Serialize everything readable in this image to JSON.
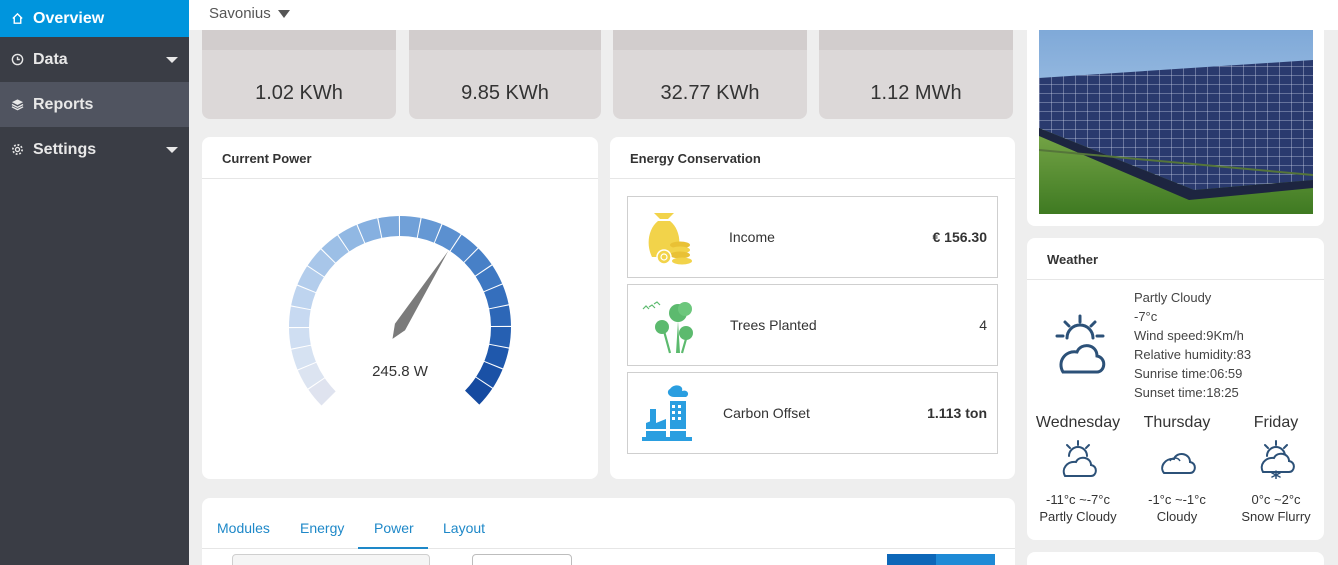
{
  "sidebar": {
    "items": [
      {
        "label": "Overview",
        "icon": "home-icon"
      },
      {
        "label": "Data",
        "icon": "clock-icon"
      },
      {
        "label": "Reports",
        "icon": "layers-icon"
      },
      {
        "label": "Settings",
        "icon": "gear-icon"
      }
    ],
    "accent": "#0095dd"
  },
  "topbar": {
    "site": "Savonius"
  },
  "stats": [
    {
      "value": "1.02 KWh"
    },
    {
      "value": "9.85 KWh"
    },
    {
      "value": "32.77 KWh"
    },
    {
      "value": "1.12 MWh"
    }
  ],
  "current_power": {
    "title": "Current Power",
    "reading": "245.8 W",
    "needle_level": 0.62
  },
  "energy_conservation": {
    "title": "Energy Conservation",
    "rows": [
      {
        "label": "Income",
        "value": "€ 156.30",
        "icon": "money-bag-icon"
      },
      {
        "label": "Trees Planted",
        "value": "4",
        "icon": "trees-icon"
      },
      {
        "label": "Carbon Offset",
        "value": "1.113 ton",
        "icon": "factory-icon"
      }
    ]
  },
  "weather": {
    "title": "Weather",
    "current": {
      "condition": "Partly Cloudy",
      "temp": "-7°c",
      "wind": "Wind speed:9Km/h",
      "humidity": "Relative humidity:83",
      "sunrise": "Sunrise time:06:59",
      "sunset": "Sunset time:18:25"
    },
    "forecast": [
      {
        "day": "Wednesday",
        "range": "-11°c ~-7°c",
        "condition": "Partly Cloudy",
        "icon": "partly-cloudy-icon"
      },
      {
        "day": "Thursday",
        "range": "-1°c ~-1°c",
        "condition": "Cloudy",
        "icon": "cloud-icon"
      },
      {
        "day": "Friday",
        "range": "0°c ~2°c",
        "condition": "Snow Flurry",
        "icon": "snow-flurry-icon"
      }
    ]
  },
  "tabs": [
    {
      "label": "Modules"
    },
    {
      "label": "Energy"
    },
    {
      "label": "Power",
      "active": true
    },
    {
      "label": "Layout"
    }
  ]
}
